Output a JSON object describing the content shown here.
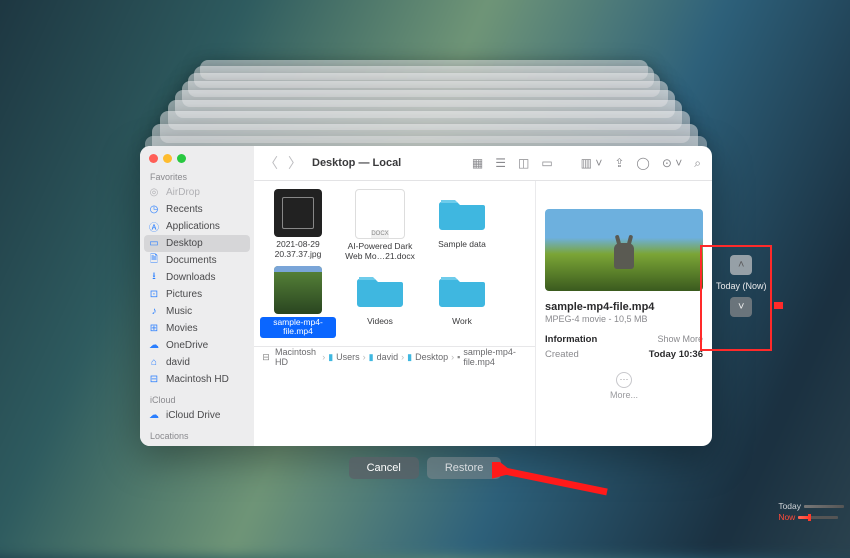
{
  "window": {
    "title": "Desktop — Local",
    "traffic": {
      "close": "#ff5f57",
      "min": "#febc2e",
      "max": "#28c840"
    }
  },
  "sidebar": {
    "sections": [
      "Favorites",
      "iCloud",
      "Locations"
    ],
    "items": [
      {
        "label": "AirDrop",
        "icon": "airdrop-icon",
        "disabled": true
      },
      {
        "label": "Recents",
        "icon": "clock-icon"
      },
      {
        "label": "Applications",
        "icon": "applications-icon"
      },
      {
        "label": "Desktop",
        "icon": "desktop-icon",
        "selected": true
      },
      {
        "label": "Documents",
        "icon": "documents-icon"
      },
      {
        "label": "Downloads",
        "icon": "downloads-icon"
      },
      {
        "label": "Pictures",
        "icon": "pictures-icon"
      },
      {
        "label": "Music",
        "icon": "music-icon"
      },
      {
        "label": "Movies",
        "icon": "movies-icon"
      },
      {
        "label": "OneDrive",
        "icon": "cloud-icon"
      },
      {
        "label": "david",
        "icon": "home-icon"
      },
      {
        "label": "Macintosh HD",
        "icon": "drive-icon"
      }
    ],
    "icloud": [
      {
        "label": "iCloud Drive",
        "icon": "icloud-icon"
      }
    ]
  },
  "items": [
    {
      "label": "2021-08-29 20.37.37.jpg",
      "kind": "img"
    },
    {
      "label": "AI-Powered Dark Web Mo…21.docx",
      "kind": "doc",
      "doc_ext": "DOCX"
    },
    {
      "label": "Sample data",
      "kind": "folder"
    },
    {
      "label": "sample-mp4-file.mp4",
      "kind": "vid",
      "selected": true
    },
    {
      "label": "Videos",
      "kind": "folder"
    },
    {
      "label": "Work",
      "kind": "folder"
    }
  ],
  "pathbar": [
    "Macintosh HD",
    "Users",
    "david",
    "Desktop",
    "sample-mp4-file.mp4"
  ],
  "preview": {
    "name": "sample-mp4-file.mp4",
    "meta": "MPEG-4 movie - 10,5 MB",
    "info_header": "Information",
    "show_more": "Show More",
    "created_label": "Created",
    "created_value": "Today 10:36",
    "more": "More..."
  },
  "actions": {
    "cancel": "Cancel",
    "restore": "Restore"
  },
  "time_nav": {
    "label": "Today (Now)"
  },
  "timeline": {
    "today": "Today",
    "now": "Now"
  }
}
